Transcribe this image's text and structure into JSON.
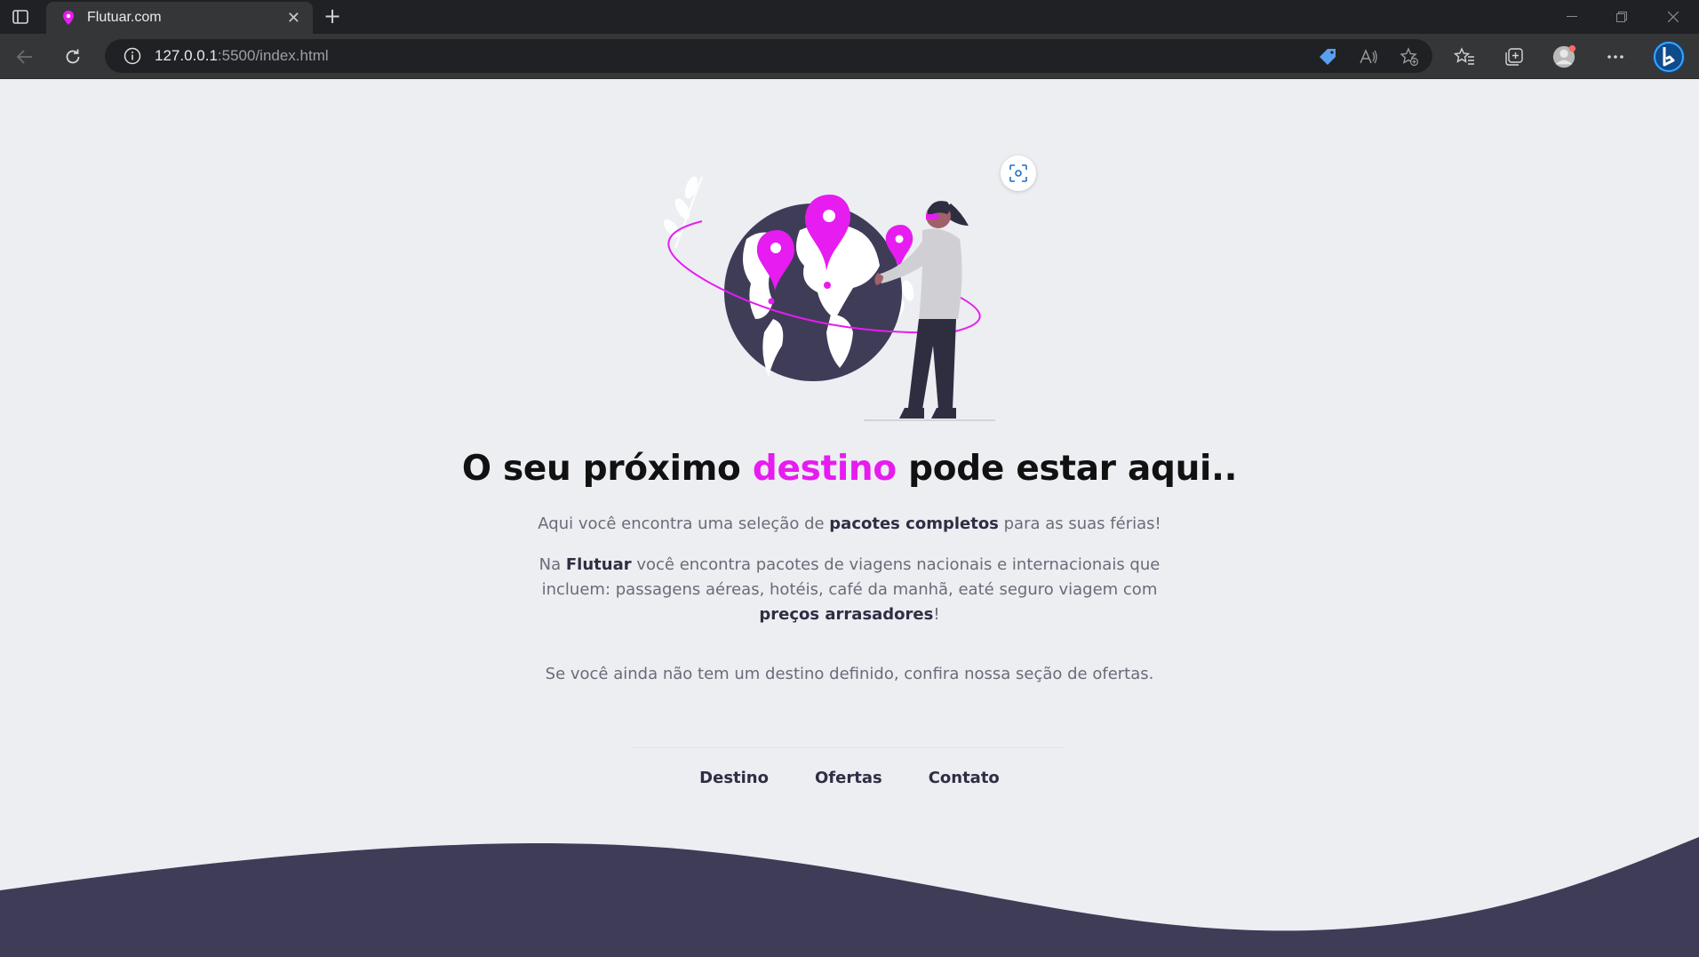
{
  "browser": {
    "tab_title": "Flutuar.com",
    "new_tab_symbol": "+",
    "close_symbol": "✕",
    "url_host": "127.0.0.1",
    "url_path": ":5500/index.html"
  },
  "colors": {
    "accent": "#e61cf0",
    "dark": "#3f3c58",
    "background": "#eceef2"
  },
  "hero": {
    "title_prefix": "O seu próximo ",
    "title_accent": "destino",
    "title_suffix": " pode estar aqui..",
    "intro_pre": "Aqui você encontra uma seleção de ",
    "intro_bold": "pacotes completos",
    "intro_post": " para as suas férias!",
    "body_pre": "Na ",
    "body_brand": "Flutuar",
    "body_mid": " você encontra pacotes de viagens nacionais e internacionais que incluem: passagens aéreas, hotéis, café da manhã, eaté seguro viagem com ",
    "body_bold": "preços arrasadores",
    "body_end": "!",
    "offers_note": "Se você ainda não tem um destino definido, confira nossa seção de ofertas."
  },
  "nav": {
    "items": [
      "Destino",
      "Ofertas",
      "Contato"
    ]
  }
}
